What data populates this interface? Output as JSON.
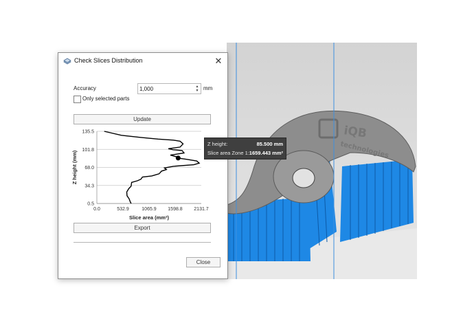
{
  "dialog": {
    "title": "Check Slices Distribution",
    "close_glyph": "✕",
    "accuracy_label": "Accuracy",
    "accuracy_value": "1,000",
    "accuracy_unit": "mm",
    "only_selected_label": "Only selected parts",
    "only_selected_checked": false,
    "update_label": "Update",
    "export_label": "Export",
    "close_label": "Close"
  },
  "tooltip": {
    "z_label": "Z height:",
    "z_value": "85.500 mm",
    "area_label": "Slice area Zone 1:",
    "area_value": "1659.443 mm²"
  },
  "chart_data": {
    "type": "line",
    "xlabel": "Slice area (mm²)",
    "ylabel": "Z height (mm)",
    "x_ticks": [
      "0.0",
      "532.9",
      "1065.9",
      "1598.8",
      "2131.7"
    ],
    "y_ticks": [
      "135.5",
      "101.8",
      "68.0",
      "34.3",
      "0.5"
    ],
    "xlim": [
      0,
      2131.7
    ],
    "ylim": [
      0.5,
      135.5
    ],
    "series": [
      {
        "points": [
          [
            150,
            135.5
          ],
          [
            500,
            128
          ],
          [
            900,
            124
          ],
          [
            1250,
            121
          ],
          [
            1560,
            119
          ],
          [
            1700,
            117
          ],
          [
            1760,
            112
          ],
          [
            1700,
            106
          ],
          [
            1460,
            103
          ],
          [
            1560,
            101
          ],
          [
            1740,
            99.5
          ],
          [
            1780,
            95
          ],
          [
            1640,
            93
          ],
          [
            1500,
            91
          ],
          [
            1620,
            88
          ],
          [
            1659.443,
            85.5
          ],
          [
            1840,
            83
          ],
          [
            2040,
            80
          ],
          [
            2090,
            76
          ],
          [
            1980,
            73
          ],
          [
            1560,
            70
          ],
          [
            1380,
            67
          ],
          [
            1420,
            64
          ],
          [
            1320,
            61
          ],
          [
            1270,
            56
          ],
          [
            1120,
            52
          ],
          [
            930,
            50
          ],
          [
            900,
            46
          ],
          [
            830,
            43
          ],
          [
            710,
            40
          ],
          [
            700,
            33
          ],
          [
            650,
            28
          ],
          [
            610,
            22
          ],
          [
            615,
            15
          ],
          [
            660,
            9
          ],
          [
            680,
            4
          ],
          [
            700,
            0.5
          ]
        ]
      }
    ],
    "marker": {
      "x": 1659.443,
      "y": 85.5
    },
    "grid": true
  }
}
